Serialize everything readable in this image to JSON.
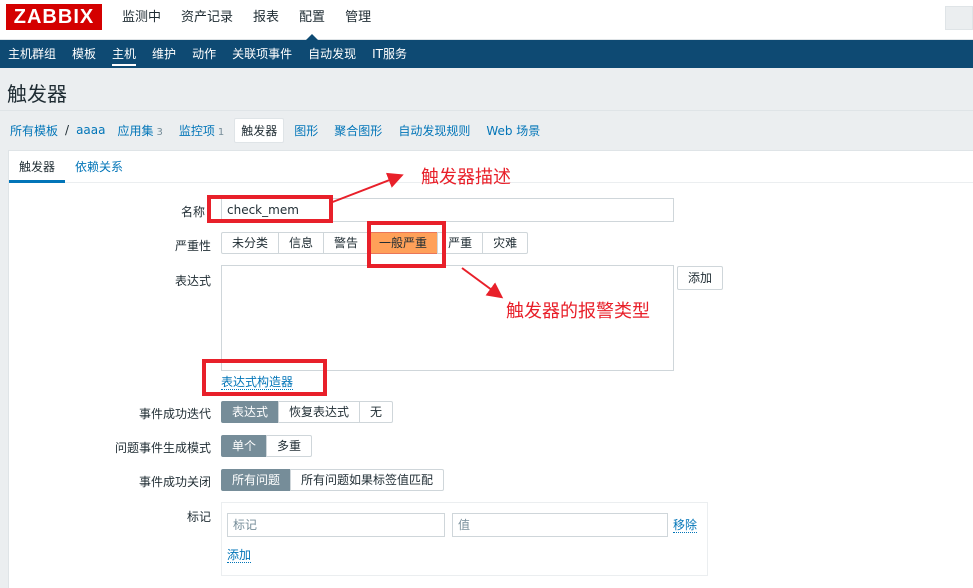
{
  "brand": {
    "logo": "ZABBIX",
    "color": "#d40000"
  },
  "top_nav": [
    "监测中",
    "资产记录",
    "报表",
    "配置",
    "管理"
  ],
  "top_nav_active": "配置",
  "sub_nav": [
    "主机群组",
    "模板",
    "主机",
    "维护",
    "动作",
    "关联项事件",
    "自动发现",
    "IT服务"
  ],
  "sub_nav_active": "主机",
  "page_title": "触发器",
  "breadcrumb": {
    "all_templates": "所有模板",
    "separator": "/",
    "template": "aaaa",
    "tabs": [
      {
        "label": "应用集",
        "count": "3"
      },
      {
        "label": "监控项",
        "count": "1"
      },
      {
        "label": "触发器",
        "count": ""
      },
      {
        "label": "图形",
        "count": ""
      },
      {
        "label": "聚合图形",
        "count": ""
      },
      {
        "label": "自动发现规则",
        "count": ""
      },
      {
        "label": "Web 场景",
        "count": ""
      }
    ],
    "active_tab": "触发器"
  },
  "form_tabs": [
    "触发器",
    "依赖关系"
  ],
  "form": {
    "name_label": "名称",
    "name_value": "check_mem",
    "severity_label": "严重性",
    "severity_options": [
      "未分类",
      "信息",
      "警告",
      "一般严重",
      "严重",
      "灾难"
    ],
    "severity_selected": "一般严重",
    "expression_label": "表达式",
    "add_button": "添加",
    "expression_builder_link": "表达式构造器",
    "ok_event_label": "事件成功迭代",
    "ok_event_options": [
      "表达式",
      "恢复表达式",
      "无"
    ],
    "ok_event_selected": "表达式",
    "problem_mode_label": "问题事件生成模式",
    "problem_mode_options": [
      "单个",
      "多重"
    ],
    "problem_mode_selected": "单个",
    "ok_close_label": "事件成功关闭",
    "ok_close_options": [
      "所有问题",
      "所有问题如果标签值匹配"
    ],
    "ok_close_selected": "所有问题",
    "tags_label": "标记",
    "tag_placeholder": "标记",
    "value_placeholder": "值",
    "remove_link": "移除",
    "add_link": "添加"
  },
  "annotations": {
    "name_note": "触发器描述",
    "severity_note": "触发器的报警类型",
    "color": "#e8202a"
  },
  "colors": {
    "header_blue": "#0e4a73",
    "link_blue": "#0275b8",
    "selected_gray": "#768d99",
    "average_orange": "#ffa059"
  }
}
